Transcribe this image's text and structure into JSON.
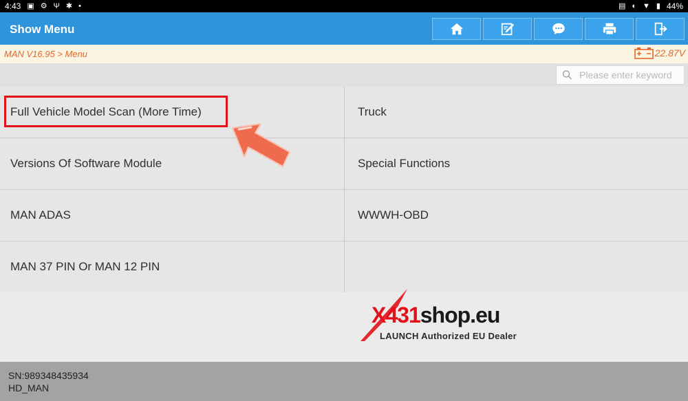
{
  "statusbar": {
    "time": "4:43",
    "battery": "44%"
  },
  "header": {
    "title": "Show Menu"
  },
  "toolbar": {
    "buttons": [
      {
        "icon": "home-icon"
      },
      {
        "icon": "edit-icon"
      },
      {
        "icon": "chat-icon"
      },
      {
        "icon": "print-icon"
      },
      {
        "icon": "exit-icon"
      }
    ]
  },
  "breadcrumb": {
    "path": "MAN V16.95 > Menu",
    "voltage": "22.87V"
  },
  "search": {
    "placeholder": "Please enter keyword",
    "value": ""
  },
  "menu": {
    "items": [
      "Full Vehicle Model Scan (More Time)",
      "Truck",
      "Versions Of Software Module",
      "Special Functions",
      "MAN ADAS",
      "WWWH-OBD",
      "MAN 37 PIN Or MAN 12 PIN",
      ""
    ]
  },
  "watermark": {
    "x": "X",
    "num": "431",
    "rest": "shop.eu",
    "tagline": "LAUNCH Authorized EU Dealer"
  },
  "footer": {
    "serial": "SN:989348435934",
    "model": "HD_MAN"
  },
  "colors": {
    "title_bar": "#2e95dc",
    "accent_orange": "#e0692a",
    "highlight_red": "#e3121a",
    "arrow": "#ee6b4d"
  }
}
